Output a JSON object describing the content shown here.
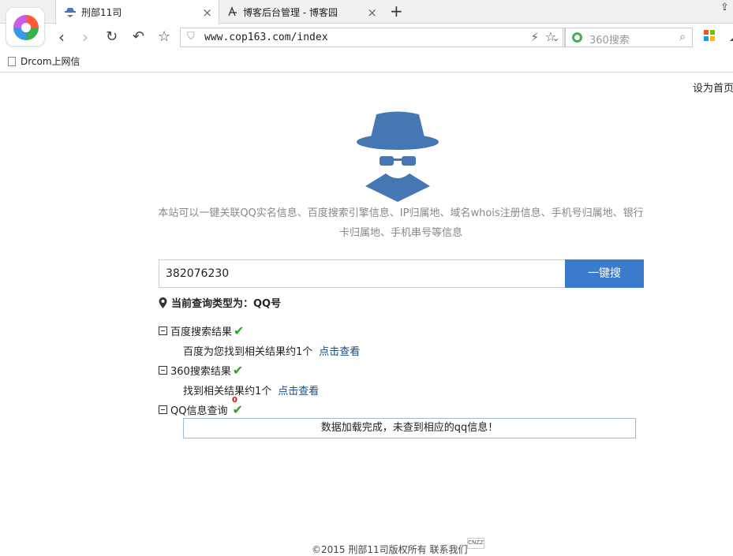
{
  "browser": {
    "tabs": [
      {
        "title": "刑部11司",
        "active": true
      },
      {
        "title": "博客后台管理 - 博客园",
        "active": false
      }
    ],
    "address": "www.cop163.com/index",
    "search_placeholder": "360搜索",
    "bookmarks": [
      "Drcom上网信"
    ],
    "icons": {
      "back": "chevron-left-icon",
      "forward": "chevron-right-icon",
      "reload": "reload-icon",
      "undo": "undo-icon",
      "favorite": "star-icon"
    }
  },
  "page": {
    "set_home": "设为首页",
    "intro": "本站可以一键关联QQ实名信息、百度搜索引擎信息、IP归属地、域名whois注册信息、手机号归属地、银行卡归属地、手机串号等信息",
    "search_value": "382076230",
    "search_button": "一键搜",
    "query_type_label": "当前查询类型为：QQ号",
    "sections": [
      {
        "title": "百度搜索结果",
        "result": "百度为您找到相关结果约1个",
        "link": "点击查看"
      },
      {
        "title": "360搜索结果",
        "result": "找到相关结果约1个",
        "link": "点击查看"
      },
      {
        "title": "QQ信息查询",
        "badge": "0"
      }
    ],
    "qq_message": "数据加载完成，未查到相应的qq信息！",
    "footer": "©2015 刑部11司版权所有 联系我们",
    "cnzz": "CNZZ",
    "accent_color": "#3b7bcb",
    "mascot_color": "#4677b5",
    "check_color": "#2ca02c"
  }
}
